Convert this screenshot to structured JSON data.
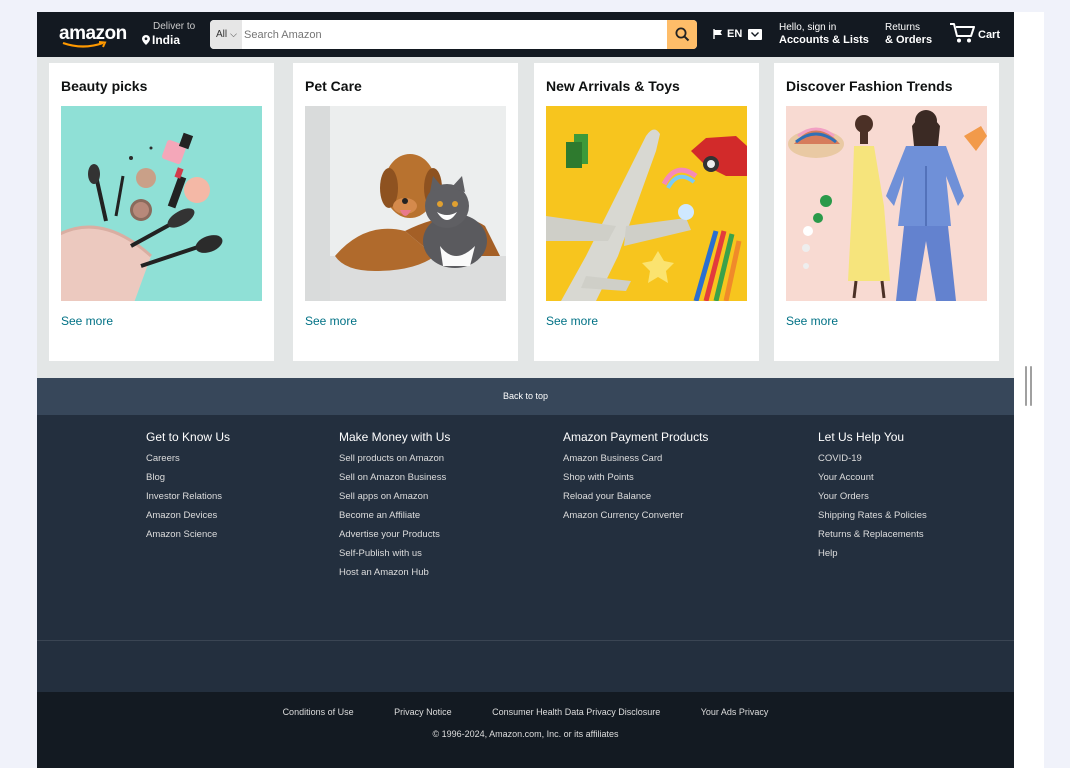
{
  "header": {
    "logo": "amazon",
    "deliver_small": "Deliver to",
    "deliver_big": "India",
    "search_scope": "All",
    "search_placeholder": "Search Amazon",
    "language": "EN",
    "account_small": "Hello, sign in",
    "account_big": "Accounts & Lists",
    "returns_small": "Returns",
    "returns_big": "& Orders",
    "cart": "Cart"
  },
  "cards": [
    {
      "title": "Beauty picks",
      "link": "See more"
    },
    {
      "title": "Pet Care",
      "link": "See more"
    },
    {
      "title": "New Arrivals & Toys",
      "link": "See more"
    },
    {
      "title": "Discover Fashion Trends",
      "link": "See more"
    }
  ],
  "footer": {
    "back_to_top": "Back to top",
    "columns": [
      {
        "heading": "Get to Know Us",
        "links": [
          "Careers",
          "Blog",
          "Investor Relations",
          "Amazon Devices",
          "Amazon Science"
        ]
      },
      {
        "heading": "Make Money with Us",
        "links": [
          "Sell products on Amazon",
          "Sell on Amazon Business",
          "Sell apps on Amazon",
          "Become an Affiliate",
          "Advertise your Products",
          "Self-Publish with us",
          "Host an Amazon Hub"
        ]
      },
      {
        "heading": "Amazon Payment Products",
        "links": [
          "Amazon Business Card",
          "Shop with Points",
          "Reload your Balance",
          "Amazon Currency Converter"
        ]
      },
      {
        "heading": "Let Us Help You",
        "links": [
          "COVID-19",
          "Your Account",
          "Your Orders",
          "Shipping Rates & Policies",
          "Returns & Replacements",
          "Help"
        ]
      }
    ],
    "legal_links": [
      "Conditions of Use",
      "Privacy Notice",
      "Consumer Health Data Privacy Disclosure",
      "Your Ads Privacy"
    ],
    "copyright": "© 1996-2024, Amazon.com, Inc. or its affiliates"
  },
  "colors": {
    "nav_bg": "#131921",
    "search_button": "#febd69",
    "link": "#007185",
    "back_to_top_bg": "#37475a",
    "footer_bg": "#232f3e",
    "footer_bottom_bg": "#131a22"
  }
}
